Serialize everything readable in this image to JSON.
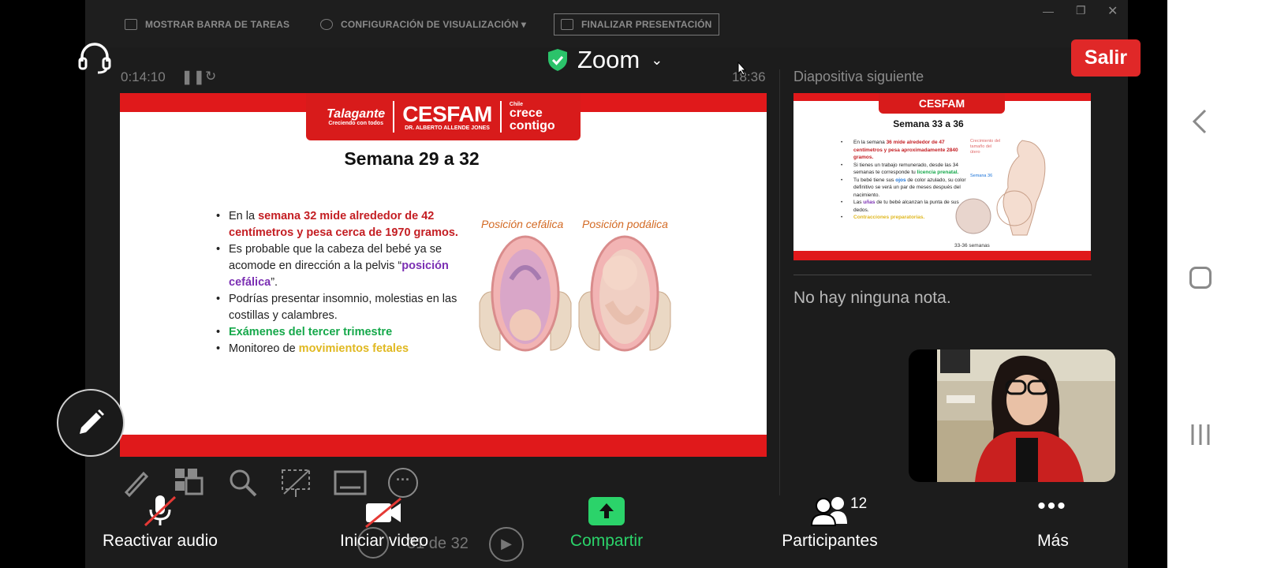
{
  "presenter_window": {
    "show_taskbar": "MOSTRAR BARRA DE TAREAS",
    "display_settings": "CONFIGURACIÓN DE VISUALIZACIÓN ▾",
    "end_presentation": "FINALIZAR PRESENTACIÓN",
    "elapsed_time": "0:14:10",
    "clock": "18:36",
    "next_slide_label": "Diapositiva siguiente",
    "notes_text": "No hay ninguna nota.",
    "slide_counter": "31 de 32"
  },
  "zoom_header": {
    "title": "Zoom",
    "leave_button": "Salir",
    "accent": "#e02828",
    "shield_color": "#2bc36a"
  },
  "current_slide": {
    "logo_left": "Talagante",
    "logo_left_sub": "Creciendo con todos",
    "logo_main": "CESFAM",
    "logo_main_sub": "DR. ALBERTO ALLENDE JONES",
    "logo_right_small": "Chile",
    "logo_right": "crece contigo",
    "title": "Semana 29 a 32",
    "bullet1_pre": "En la ",
    "bullet1_red": "semana 32 mide alrededor de 42 centímetros y pesa cerca de 1970 gramos.",
    "bullet2_pre": "Es probable que la cabeza del bebé ya se acomode en dirección a la pelvis “",
    "bullet2_purple": "posición cefálica",
    "bullet2_post": "”.",
    "bullet3": "Podrías presentar insomnio, molestias en las costillas y calambres.",
    "bullet4_green": "Exámenes del tercer trimestre",
    "bullet5_pre": "Monitoreo de ",
    "bullet5_yellow": "movimientos fetales",
    "figure_label_left": "Posición cefálica",
    "figure_label_right": "Posición podálica"
  },
  "next_slide": {
    "title": "Semana 33 a 36",
    "b1_pre": "En la semana ",
    "b1_red": "36 mide alrededor de 47 centímetros y pesa aproximadamente 2840 gramos.",
    "b2_pre": "Si tienes un trabajo remunerado, desde las 34 semanas te corresponde tu ",
    "b2_green": "licencia prenatal.",
    "b3_pre": "Tu bebé tiene sus ",
    "b3_blue": "ojos",
    "b3_post": " de color azulado, su color definitivo se verá un par de meses después del nacimiento.",
    "b4_pre": "Las ",
    "b4_purple": "uñas",
    "b4_post": " de tu bebé alcanzan la punta de sus dedos.",
    "b5_yellow": "Contracciones preparatorias.",
    "label_growth": "Crecimiento del tamaño del útero",
    "label_week": "Semana 36",
    "caption": "33-36 semanas"
  },
  "toolbar": {
    "audio": "Reactivar audio",
    "video": "Iniciar video",
    "share": "Compartir",
    "participants": "Participantes",
    "participants_count": "12",
    "more": "Más",
    "share_color": "#2bd36a"
  },
  "annotation_tools": [
    "pen-icon",
    "slides-grid-icon",
    "zoom-icon",
    "laser-pointer-icon",
    "subtitles-icon",
    "more-icon"
  ]
}
